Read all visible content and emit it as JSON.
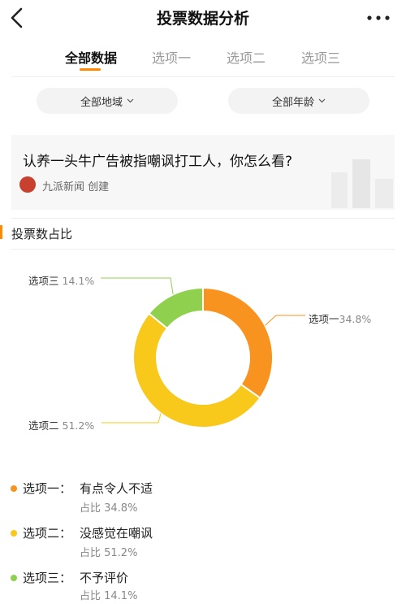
{
  "header": {
    "title": "投票数据分析"
  },
  "tabs": [
    {
      "label": "全部数据",
      "active": true
    },
    {
      "label": "选项一",
      "active": false
    },
    {
      "label": "选项二",
      "active": false
    },
    {
      "label": "选项三",
      "active": false
    }
  ],
  "filters": {
    "region": "全部地域",
    "age": "全部年龄"
  },
  "question": {
    "text": "认养一头牛广告被指嘲讽打工人，你怎么看?",
    "source": "九派新闻 创建"
  },
  "section": {
    "title": "投票数占比"
  },
  "colors": {
    "accent": "#ff8a00",
    "option1": "#f7931e",
    "option2": "#f8c81b",
    "option3": "#8fd14f"
  },
  "chart_data": {
    "type": "pie",
    "donut": true,
    "slices": [
      {
        "name": "选项一",
        "value": 34.8,
        "label": "34.8%",
        "color": "#f7931e"
      },
      {
        "name": "选项二",
        "value": 51.2,
        "label": "51.2%",
        "color": "#f8c81b"
      },
      {
        "name": "选项三",
        "value": 14.1,
        "label": "14.1%",
        "color": "#8fd14f"
      }
    ]
  },
  "legend": [
    {
      "name": "选项一：",
      "desc": "有点令人不适",
      "share": "占比 34.8%",
      "color": "#f7931e"
    },
    {
      "name": "选项二：",
      "desc": "没感觉在嘲讽",
      "share": "占比 51.2%",
      "color": "#f8c81b"
    },
    {
      "name": "选项三：",
      "desc": "不予评价",
      "share": "占比 14.1%",
      "color": "#8fd14f"
    }
  ]
}
